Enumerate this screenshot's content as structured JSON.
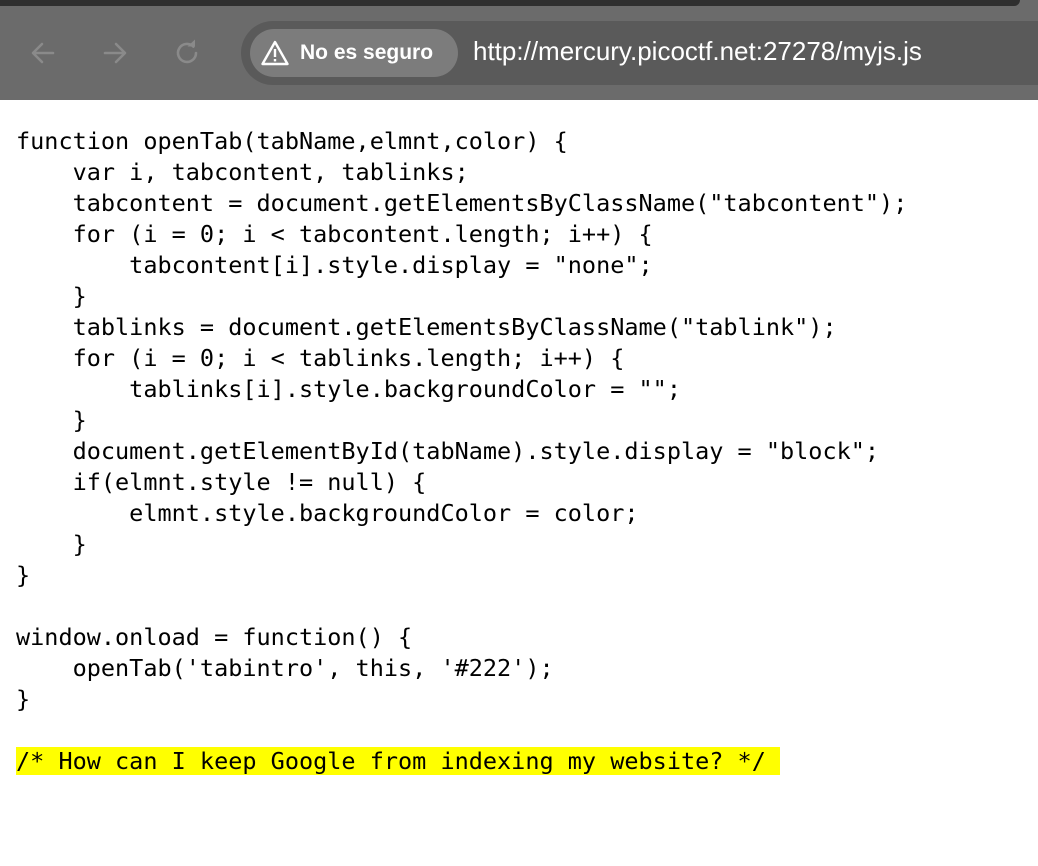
{
  "browser": {
    "back_icon": "arrow-left-icon",
    "forward_icon": "arrow-right-icon",
    "reload_icon": "reload-icon",
    "security_label": "No es seguro",
    "security_icon": "warning-triangle-icon",
    "url": "http://mercury.picoctf.net:27278/myjs.js"
  },
  "colors": {
    "chrome_bg": "#6b6b6b",
    "omnibox_bg": "#5a5a5a",
    "chip_bg": "#7c7c7c",
    "highlight": "#ffff00"
  },
  "code": {
    "lines": [
      "function openTab(tabName,elmnt,color) {",
      "    var i, tabcontent, tablinks;",
      "    tabcontent = document.getElementsByClassName(\"tabcontent\");",
      "    for (i = 0; i < tabcontent.length; i++) {",
      "        tabcontent[i].style.display = \"none\";",
      "    }",
      "    tablinks = document.getElementsByClassName(\"tablink\");",
      "    for (i = 0; i < tablinks.length; i++) {",
      "        tablinks[i].style.backgroundColor = \"\";",
      "    }",
      "    document.getElementById(tabName).style.display = \"block\";",
      "    if(elmnt.style != null) {",
      "        elmnt.style.backgroundColor = color;",
      "    }",
      "}",
      "",
      "window.onload = function() {",
      "    openTab('tabintro', this, '#222');",
      "}",
      ""
    ],
    "highlighted_comment": "/* How can I keep Google from indexing my website? */"
  }
}
